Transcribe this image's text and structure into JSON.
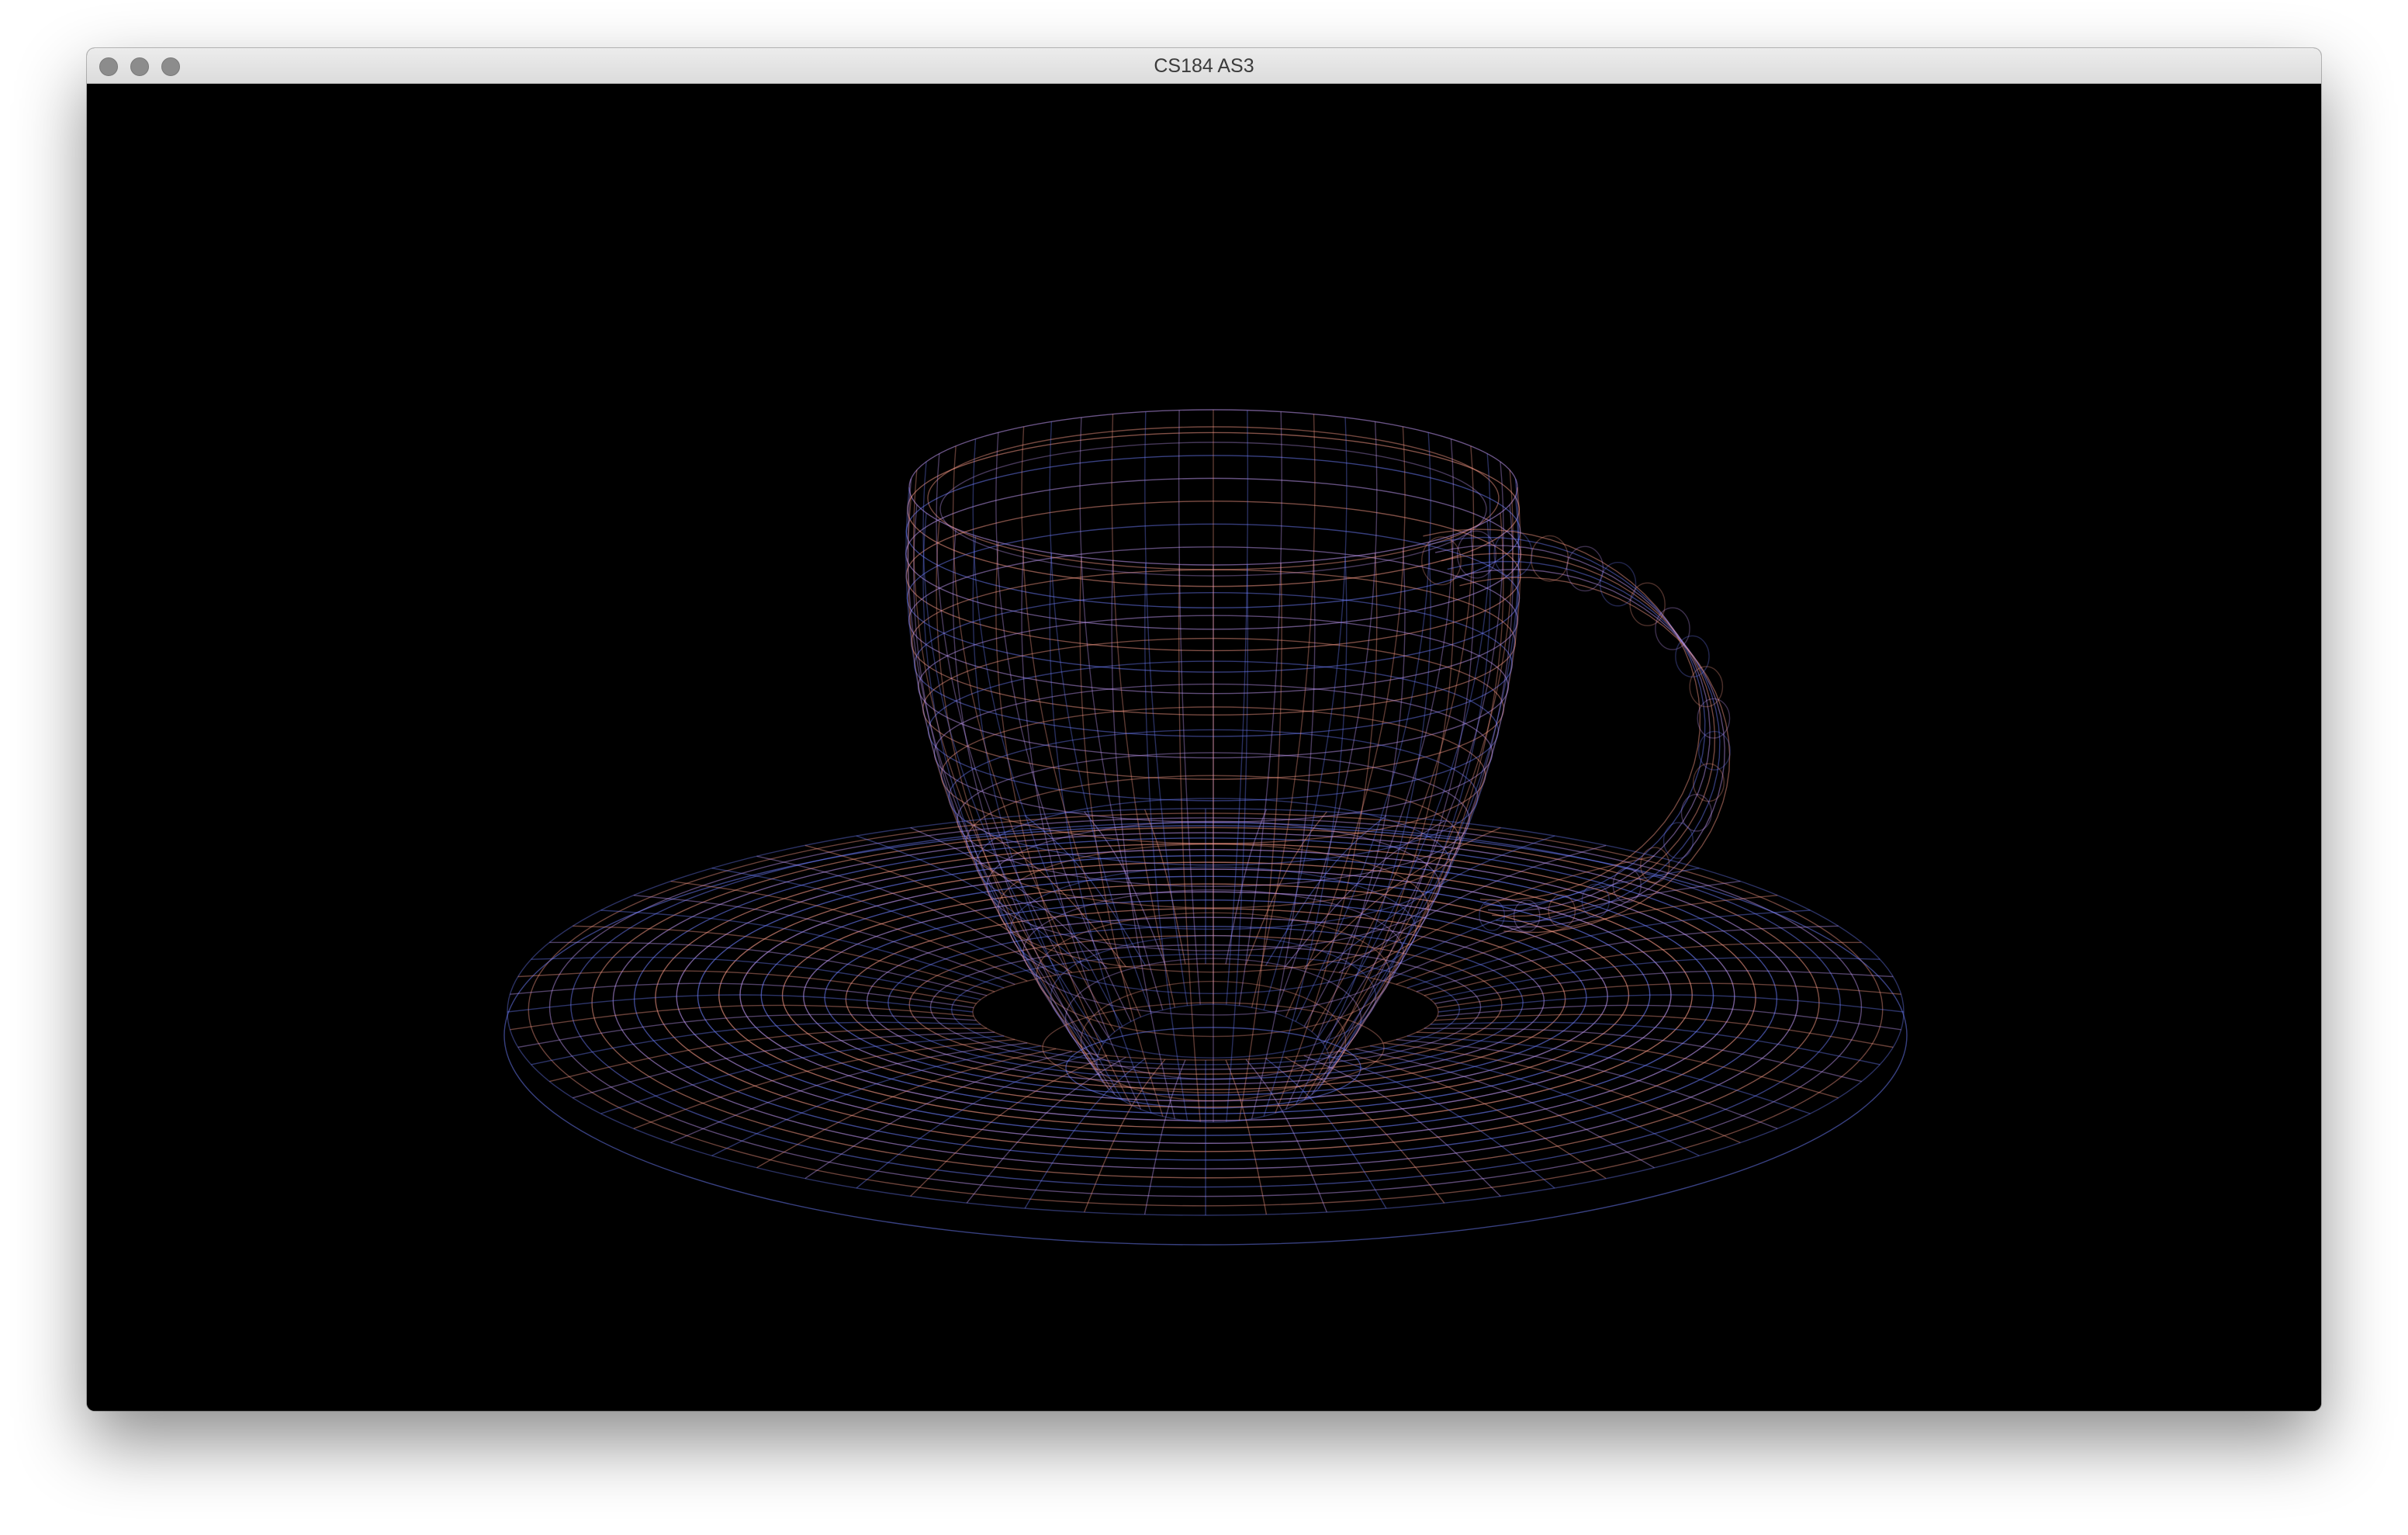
{
  "window": {
    "title": "CS184 AS3",
    "controls": [
      "close",
      "minimize",
      "zoom"
    ]
  },
  "viewport": {
    "background": "#000000",
    "scene_object": "teacup-and-saucer-wireframe",
    "render_mode": "wireframe",
    "wire_colors": [
      "#ff9e8a",
      "#6f7fff",
      "#c9a0ff"
    ]
  }
}
